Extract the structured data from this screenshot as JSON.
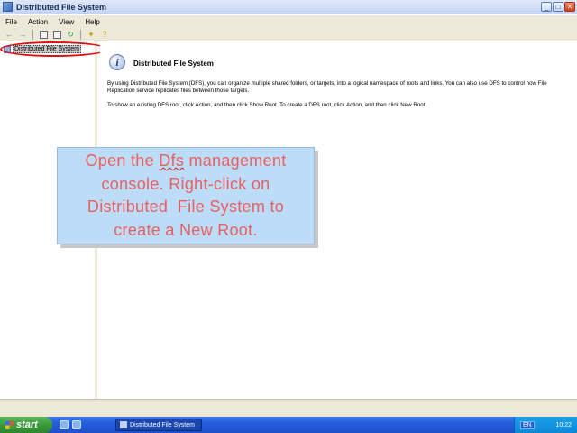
{
  "window": {
    "title": "Distributed File System",
    "buttons": [
      "_",
      "□",
      "×"
    ]
  },
  "menu": [
    "File",
    "Action",
    "View",
    "Help"
  ],
  "toolbar": {
    "icons": [
      "back-arrow-icon",
      "forward-arrow-icon",
      "console-tree-icon",
      "properties-icon",
      "refresh-icon",
      "new-root-icon",
      "help-icon"
    ]
  },
  "tree": {
    "root_label": "Distributed File System"
  },
  "detail": {
    "title": "Distributed File System",
    "paragraph1": "By using Distributed File System (DFS), you can organize multiple shared folders, or targets, into a logical namespace of roots and links. You can also use DFS to control how File Replication service replicates files between those targets.",
    "paragraph2": "To show an existing DFS root, click Action, and then click Show Root. To create a DFS root, click Action, and then click New Root."
  },
  "callout": {
    "line1_pre": "Open the ",
    "line1_squiggle": "Dfs",
    "line1_post": " management",
    "line2": "console. Right-click on",
    "line3": "Distributed  File System to",
    "line4": "create a New Root."
  },
  "taskbar": {
    "start_label": "start",
    "task_label": "Distributed File System",
    "language": "EN",
    "clock": "10:22"
  },
  "colors": {
    "callout_bg": "#bcdcf8",
    "callout_text": "#e86060",
    "highlight_ellipse": "#e01010",
    "taskbar": "#245edc",
    "start_button": "#3a9a3a"
  }
}
